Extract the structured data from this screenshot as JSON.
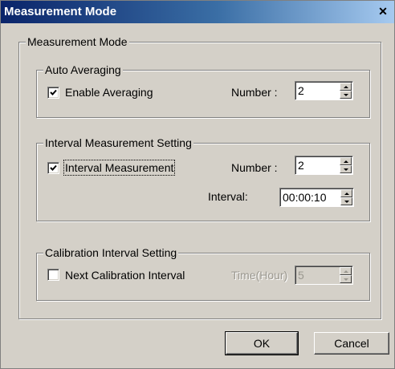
{
  "window": {
    "title": "Measurement Mode",
    "close_glyph": "✕"
  },
  "main_group": {
    "legend": "Measurement Mode"
  },
  "auto_averaging": {
    "legend": "Auto Averaging",
    "enable_label": "Enable Averaging",
    "enable_checked": true,
    "number_label": "Number :",
    "number_value": "2"
  },
  "interval_setting": {
    "legend": "Interval Measurement Setting",
    "enable_label": "Interval Measurement",
    "enable_checked": true,
    "number_label": "Number :",
    "number_value": "2",
    "interval_label": "Interval:",
    "interval_value": "00:00:10"
  },
  "calibration_setting": {
    "legend": "Calibration Interval Setting",
    "enable_label": "Next Calibration Interval",
    "enable_checked": false,
    "time_label": "Time(Hour)",
    "time_value": "5"
  },
  "buttons": {
    "ok": "OK",
    "cancel": "Cancel"
  },
  "colors": {
    "face": "#d4d0c8",
    "title_start": "#0a246a",
    "title_end": "#a6caf0",
    "disabled_text": "#9a978f"
  }
}
